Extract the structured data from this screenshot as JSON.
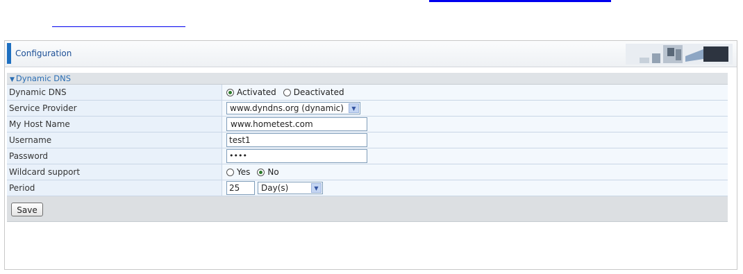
{
  "header": {
    "title": "Configuration"
  },
  "section": {
    "title": "Dynamic DNS"
  },
  "fields": {
    "dynamic_dns": {
      "label": "Dynamic DNS",
      "options": [
        "Activated",
        "Deactivated"
      ],
      "selected": "Activated"
    },
    "service_provider": {
      "label": "Service Provider",
      "value": "www.dyndns.org (dynamic)"
    },
    "host_name": {
      "label": "My Host Name",
      "value": "www.hometest.com"
    },
    "username": {
      "label": "Username",
      "value": "test1"
    },
    "password": {
      "label": "Password",
      "value": "••••"
    },
    "wildcard": {
      "label": "Wildcard support",
      "options": [
        "Yes",
        "No"
      ],
      "selected": "No"
    },
    "period": {
      "label": "Period",
      "value": "25",
      "unit": "Day(s)"
    }
  },
  "buttons": {
    "save": "Save"
  },
  "colors": {
    "accent": "#1e6fc0",
    "title": "#1c4f96",
    "link": "#0000ee"
  },
  "icons": {
    "header_art": "network-banner-graphic",
    "select_arrow": "chevron-down-icon"
  }
}
